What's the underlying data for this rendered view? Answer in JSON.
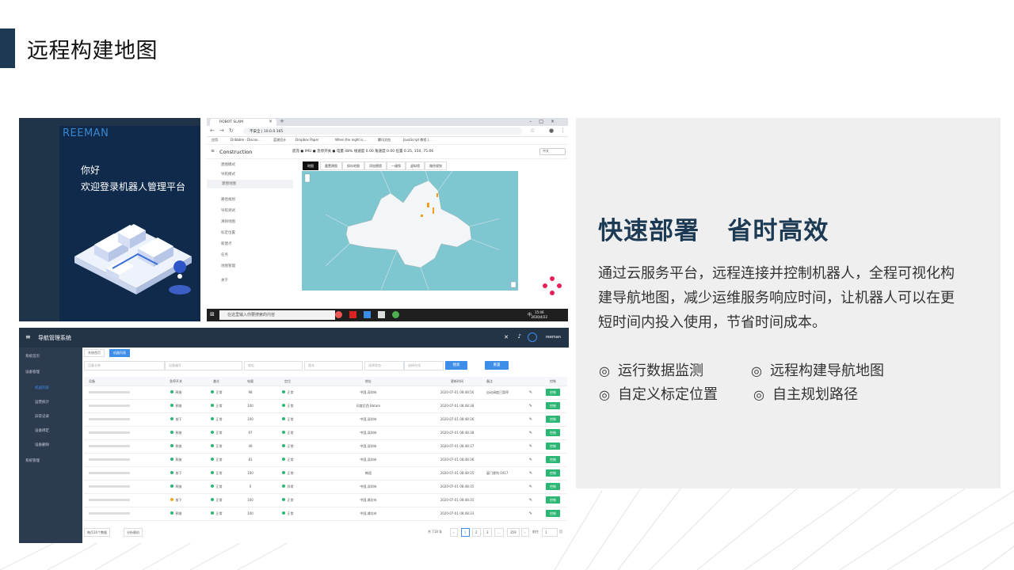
{
  "slide": {
    "title": "远程构建地图",
    "headline": "快速部署   省时高效",
    "description": "通过云服务平台，远程连接并控制机器人，全程可视化构建导航地图，减少运维服务响应时间，让机器人可以在更短时间内投入使用，节省时间成本。",
    "features": [
      "运行数据监测",
      "远程构建导航地图",
      "自定义标定位置",
      "自主规划路径"
    ],
    "feature_marker": "◎",
    "colors": {
      "accent": "#1d3a55",
      "panel": "#efefef"
    }
  },
  "login_screen": {
    "brand": "REEMAN",
    "greeting": "你好",
    "welcome": "欢迎登录机器人管理平台"
  },
  "browser_screen": {
    "tab_title": "ROBOT SLAM",
    "url": "不安全 | 10.0.0.165",
    "bookmarks": [
      "应用",
      "Dribbble - Discov...",
      "蓝湖设计",
      "Dropbox Paper",
      "When the night is...",
      "腾讯文档",
      "JavaScript 教程 |..."
    ],
    "app_title": "Construction",
    "status": "底充 ●  IMU ●  急停开关 ●  电量 48%  线速度 0.00  角速度 0.00  位置 0.25, 150, 75.06",
    "mode_select": "中文",
    "menu": [
      "建图模式",
      "导航模式",
      "建图地图",
      "路径规划",
      "导航调试",
      "清除地图",
      "标定位置",
      "新建点",
      "任务",
      "地图管理",
      "关于"
    ],
    "map_tools": [
      "地图",
      "重置建图",
      "保存地图",
      "添加围墙",
      "一键保",
      "虚拟墙",
      "路径规划"
    ],
    "taskbar_search": "在这里输入你要搜索的内容",
    "clock_time": "15:46",
    "clock_date": "2020/4/22",
    "lang": "中"
  },
  "admin_screen": {
    "app_title": "导航管理系统",
    "user": "reeman",
    "sidebar": [
      "系统首页",
      "设备管理",
      "机器列表",
      "运营统计",
      "异常记录",
      "设备绑定",
      "设备删除",
      "系统管理"
    ],
    "breadcrumbs": [
      "系统首页",
      "机器列表"
    ],
    "filter_placeholders": [
      "设备名称",
      "设备编号",
      "地址",
      "版本",
      "选择状态",
      "选择在线"
    ],
    "search_button": "搜索",
    "reset_button": "重置",
    "columns": [
      "设备",
      "急停开关",
      "激光",
      "电量",
      "定位",
      "地址",
      "更新时间",
      "备注",
      "控制"
    ],
    "rows": [
      {
        "estop": "释放",
        "laser": "正常",
        "battery": "98",
        "loc": "正常",
        "address": "中国,深圳市",
        "time": "2020-07-01 08:48:56",
        "note": "自动调度已暂停",
        "dot": "green"
      },
      {
        "estop": "释放",
        "laser": "正常",
        "battery": "100",
        "loc": "正常",
        "address": "印度尼西 Batam",
        "time": "2020-07-01 08:48:38",
        "note": "",
        "dot": "green"
      },
      {
        "estop": "按下",
        "laser": "正常",
        "battery": "100",
        "loc": "正常",
        "address": "中国,深圳市",
        "time": "2020-07-01 08:48:36",
        "note": "",
        "dot": "green"
      },
      {
        "estop": "释放",
        "laser": "正常",
        "battery": "97",
        "loc": "正常",
        "address": "中国,深圳市",
        "time": "2020-07-01 08:48:38",
        "note": "",
        "dot": "green"
      },
      {
        "estop": "释放",
        "laser": "正常",
        "battery": "49",
        "loc": "正常",
        "address": "中国,深圳市",
        "time": "2020-07-01 08:48:37",
        "note": "",
        "dot": "green"
      },
      {
        "estop": "释放",
        "laser": "正常",
        "battery": "81",
        "loc": "正常",
        "address": "中国,深圳市",
        "time": "2020-07-01 08:48:36",
        "note": "",
        "dot": "green"
      },
      {
        "estop": "按下",
        "laser": "正常",
        "battery": "100",
        "loc": "正常",
        "address": "韩国",
        "time": "2020-07-01 08:48:35",
        "note": "厦门便利 0417",
        "dot": "green"
      },
      {
        "estop": "释放",
        "laser": "正常",
        "battery": "0",
        "loc": "异常",
        "address": "中国,深圳市",
        "time": "2020-07-01 08:48:35",
        "note": "",
        "dot": "green"
      },
      {
        "estop": "按下",
        "laser": "正常",
        "battery": "100",
        "loc": "正常",
        "address": "中国,潍坊市",
        "time": "2020-07-01 08:48:35",
        "note": "",
        "dot": "orange"
      },
      {
        "estop": "释放",
        "laser": "正常",
        "battery": "100",
        "loc": "正常",
        "address": "中国,潍坊市",
        "time": "2020-07-01 08:48:33",
        "note": "",
        "dot": "green"
      }
    ],
    "row_button": "控制",
    "pager": {
      "total": "共 718 条",
      "pages": [
        "1",
        "2",
        "3",
        "...",
        "359"
      ],
      "goto": "前往",
      "goto_value": "1",
      "page_unit": "页",
      "page_size": "每页10个数据",
      "sort": "分析随机"
    }
  }
}
